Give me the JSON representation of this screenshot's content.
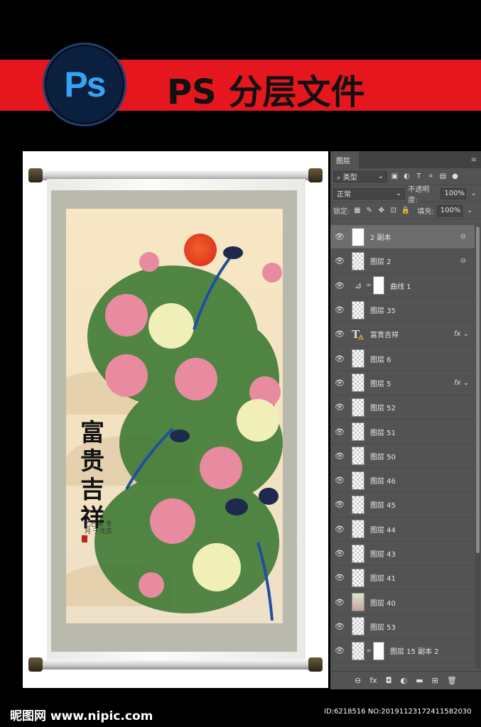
{
  "banner": {
    "logo_text": "Ps",
    "title": "PS 分层文件",
    "color": "#e5161e"
  },
  "artwork": {
    "calligraphy": [
      "富",
      "贵",
      "吉",
      "祥"
    ],
    "inscription": "乙巳年 冬月 于北京"
  },
  "panel": {
    "tab": "图层",
    "menu_icon": "menu-icon",
    "filter_label": "类型",
    "blend_mode": "正常",
    "opacity_label": "不透明度:",
    "opacity_value": "100%",
    "lock_label": "锁定:",
    "fill_label": "填充:",
    "fill_value": "100%",
    "layers": [
      {
        "name": "2 副本",
        "selected": true,
        "thumb": "white",
        "link": true
      },
      {
        "name": "图层 2",
        "link": true
      },
      {
        "name": "曲线 1",
        "kind": "adjustment"
      },
      {
        "name": "图层 35"
      },
      {
        "name": "富贵吉祥",
        "kind": "text",
        "fx": true
      },
      {
        "name": "图层 6"
      },
      {
        "name": "图层 5",
        "fx": true
      },
      {
        "name": "图层 52"
      },
      {
        "name": "图层 51"
      },
      {
        "name": "图层 50"
      },
      {
        "name": "图层 46"
      },
      {
        "name": "图层 45"
      },
      {
        "name": "图层 44"
      },
      {
        "name": "图层 43"
      },
      {
        "name": "图层 41"
      },
      {
        "name": "图层 40",
        "thumb": "img"
      },
      {
        "name": "图层 53"
      },
      {
        "name": "图层 15 副本 2",
        "kind": "masked"
      }
    ],
    "bottom_icons": [
      "⊖",
      "fx",
      "◘",
      "◐",
      "▬",
      "⊞",
      "🗑"
    ]
  },
  "footer": {
    "left": "昵图网 www.nipic.com",
    "right": "ID:6218516 NO:20191123172411582030"
  }
}
